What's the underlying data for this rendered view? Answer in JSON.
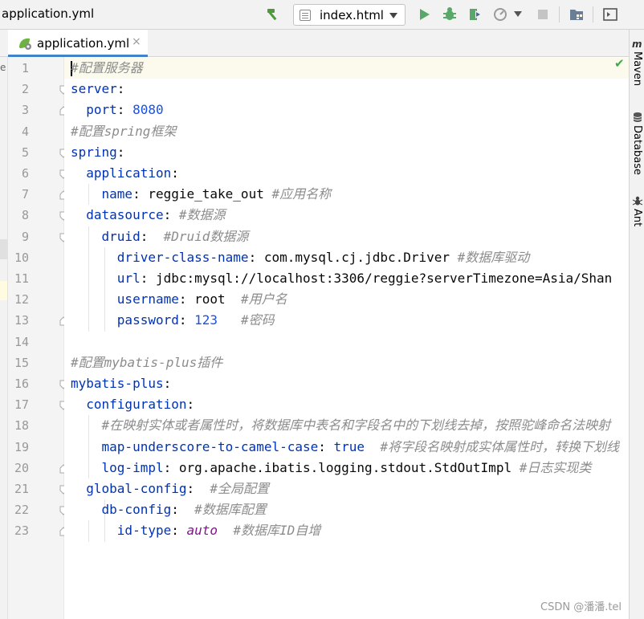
{
  "window": {
    "breadcrumb": "application.yml"
  },
  "toolbar": {
    "run_config": "index.html",
    "icons": [
      "hammer-icon",
      "file-html-icon",
      "chevron-down-icon",
      "run-icon",
      "debug-icon",
      "coverage-icon",
      "profile-icon",
      "stop-icon",
      "project-structure-icon",
      "terminal-icon"
    ]
  },
  "tabs": [
    {
      "label": "application.yml",
      "close": "×",
      "active": true
    }
  ],
  "left_strip": {
    "label": "e"
  },
  "editor": {
    "lines": [
      {
        "n": "1",
        "indent": "",
        "comment": "#配置服务器"
      },
      {
        "n": "2",
        "indent": "",
        "key": "server",
        "colon": ":"
      },
      {
        "n": "3",
        "indent": "  ",
        "key": "port",
        "colon": ":",
        "value": " 8080"
      },
      {
        "n": "4",
        "indent": "",
        "comment": "#配置spring框架"
      },
      {
        "n": "5",
        "indent": "",
        "key": "spring",
        "colon": ":"
      },
      {
        "n": "6",
        "indent": "  ",
        "key": "application",
        "colon": ":"
      },
      {
        "n": "7",
        "indent": "    ",
        "key": "name",
        "colon": ":",
        "value": " reggie_take_out ",
        "comment": "#应用名称"
      },
      {
        "n": "8",
        "indent": "  ",
        "key": "datasource",
        "colon": ":",
        "value": " ",
        "comment": "#数据源"
      },
      {
        "n": "9",
        "indent": "    ",
        "key": "druid",
        "colon": ":",
        "value": "  ",
        "comment": "#Druid数据源"
      },
      {
        "n": "10",
        "indent": "      ",
        "key": "driver-class-name",
        "colon": ":",
        "value": " com.mysql.cj.jdbc.Driver ",
        "comment": "#数据库驱动"
      },
      {
        "n": "11",
        "indent": "      ",
        "key": "url",
        "colon": ":",
        "value": " jdbc:mysql://localhost:3306/reggie?serverTimezone=Asia/Shan"
      },
      {
        "n": "12",
        "indent": "      ",
        "key": "username",
        "colon": ":",
        "value": " root  ",
        "comment": "#用户名"
      },
      {
        "n": "13",
        "indent": "      ",
        "key": "password",
        "colon": ":",
        "value": " 123   ",
        "comment": "#密码"
      },
      {
        "n": "14",
        "indent": ""
      },
      {
        "n": "15",
        "indent": "",
        "comment": "#配置mybatis-plus插件"
      },
      {
        "n": "16",
        "indent": "",
        "key": "mybatis-plus",
        "colon": ":"
      },
      {
        "n": "17",
        "indent": "  ",
        "key": "configuration",
        "colon": ":"
      },
      {
        "n": "18",
        "indent": "    ",
        "comment": "#在映射实体或者属性时，将数据库中表名和字段名中的下划线去掉，按照驼峰命名法映射"
      },
      {
        "n": "19",
        "indent": "    ",
        "key": "map-underscore-to-camel-case",
        "colon": ":",
        "value": " ",
        "bool": "true",
        "tail": "  ",
        "comment": "#将字段名映射成实体属性时，转换下划线"
      },
      {
        "n": "20",
        "indent": "    ",
        "key": "log-impl",
        "colon": ":",
        "value": " org.apache.ibatis.logging.stdout.StdOutImpl ",
        "comment": "#日志实现类"
      },
      {
        "n": "21",
        "indent": "  ",
        "key": "global-config",
        "colon": ":",
        "value": "  ",
        "comment": "#全局配置"
      },
      {
        "n": "22",
        "indent": "    ",
        "key": "db-config",
        "colon": ":",
        "value": "  ",
        "comment": "#数据库配置"
      },
      {
        "n": "23",
        "indent": "      ",
        "key": "id-type",
        "colon": ":",
        "value": " ",
        "anchor": "auto",
        "tail": "  ",
        "comment": "#数据库ID自增"
      }
    ]
  },
  "right_strip": {
    "tools": [
      {
        "label": "Maven",
        "icon": "maven-icon"
      },
      {
        "label": "Database",
        "icon": "database-icon"
      },
      {
        "label": "Ant",
        "icon": "ant-icon"
      }
    ]
  },
  "status": {
    "inspection": "✔"
  },
  "watermark": "CSDN @潘潘.tel",
  "colors": {
    "key": "#0033b3",
    "number": "#1750eb",
    "comment": "#8c8c8c",
    "anchor": "#871094",
    "tab_underline": "#4083c9"
  }
}
